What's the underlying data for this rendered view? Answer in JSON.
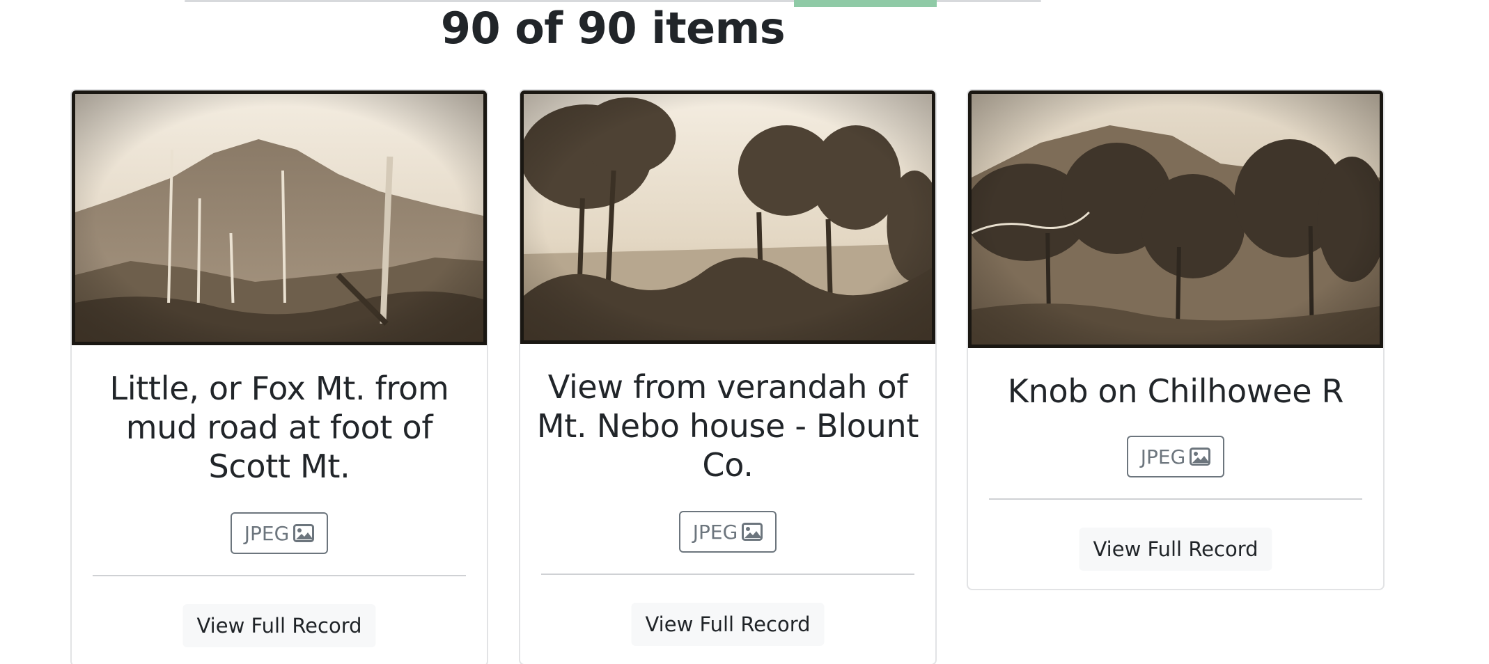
{
  "summary": {
    "count_text": "90 of 90 items"
  },
  "colors": {
    "progress_fill": "#8fcaa6",
    "sepia_light": "#ece3d2",
    "sepia_dark": "#3b3125",
    "button_border": "#6c757d"
  },
  "cards": [
    {
      "title": "Little, or Fox Mt. from mud road at foot of Scott Mt.",
      "format_label": "JPEG",
      "format_icon": "image-icon",
      "action_label": "View Full Record"
    },
    {
      "title": "View from verandah of Mt. Nebo house - Blount Co.",
      "format_label": "JPEG",
      "format_icon": "image-icon",
      "action_label": "View Full Record"
    },
    {
      "title": "Knob on Chilhowee R",
      "format_label": "JPEG",
      "format_icon": "image-icon",
      "action_label": "View Full Record"
    }
  ]
}
